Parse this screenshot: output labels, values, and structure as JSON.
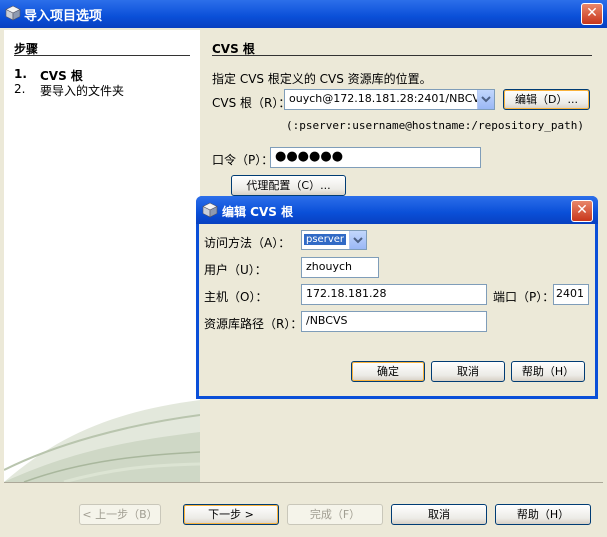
{
  "window": {
    "title": "导入项目选项",
    "close": "✕"
  },
  "steps": {
    "heading": "步骤",
    "items": [
      {
        "num": "1.",
        "label": "CVS 根"
      },
      {
        "num": "2.",
        "label": "要导入的文件夹"
      }
    ]
  },
  "panel": {
    "heading": "CVS 根",
    "description": "指定 CVS 根定义的 CVS 资源库的位置。",
    "cvs_root_label": "CVS 根（R）：",
    "cvs_root_value": "ouych@172.18.181.28:2401/NBCVS",
    "edit_button": "编辑（D）...",
    "hint": "(:pserver:username@hostname:/repository_path)",
    "password_label": "口令（P）：",
    "password_value": "●●●●●●",
    "proxy_button": "代理配置（C）..."
  },
  "dialog": {
    "title": "编辑 CVS 根",
    "access_method_label": "访问方法（A）：",
    "access_method_value": "pserver",
    "user_label": "用户（U）：",
    "user_value": "zhouych",
    "host_label": "主机（O）：",
    "host_value": "172.18.181.28",
    "port_label": "端口（P）：",
    "port_value": "2401",
    "repo_path_label": "资源库路径（R）：",
    "repo_path_value": "/NBCVS",
    "ok_button": "确定",
    "cancel_button": "取消",
    "help_button": "帮助（H）"
  },
  "footer": {
    "back_button": "< 上一步（B）",
    "next_button": "下一步 >",
    "finish_button": "完成（F）",
    "cancel_button": "取消",
    "help_button": "帮助（H）"
  }
}
